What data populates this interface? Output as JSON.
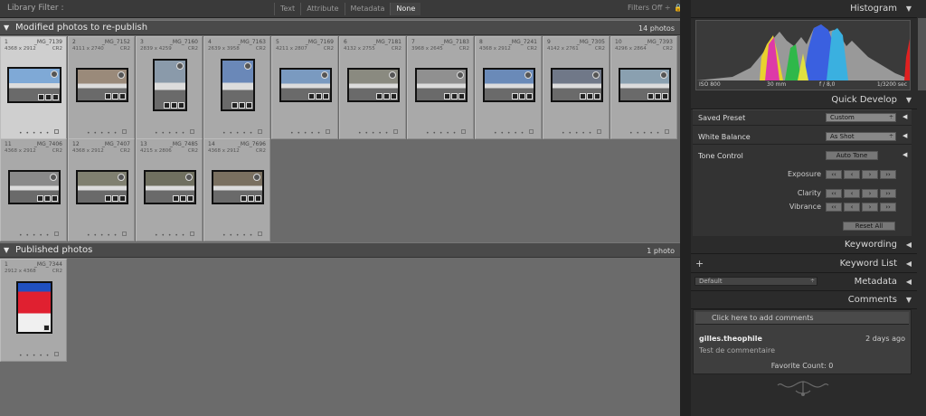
{
  "filter_bar": {
    "label": "Library Filter :",
    "options": [
      "Text",
      "Attribute",
      "Metadata",
      "None"
    ],
    "selected": "None",
    "filters_off": "Filters Off ÷"
  },
  "sections": [
    {
      "title": "Modified photos to re-publish",
      "count": "14 photos",
      "photos": [
        {
          "num": "1",
          "name": "_MG_7139",
          "dims": "4368 x 2912",
          "ext": "CR2"
        },
        {
          "num": "2",
          "name": "_MG_7152",
          "dims": "4111 x 2740",
          "ext": "CR2"
        },
        {
          "num": "3",
          "name": "_MG_7160",
          "dims": "2839 x 4259",
          "ext": "CR2"
        },
        {
          "num": "4",
          "name": "_MG_7163",
          "dims": "2639 x 3958",
          "ext": "CR2"
        },
        {
          "num": "5",
          "name": "_MG_7169",
          "dims": "4211 x 2807",
          "ext": "CR2"
        },
        {
          "num": "6",
          "name": "_MG_7181",
          "dims": "4132 x 2755",
          "ext": "CR2"
        },
        {
          "num": "7",
          "name": "_MG_7183",
          "dims": "3968 x 2645",
          "ext": "CR2"
        },
        {
          "num": "8",
          "name": "_MG_7241",
          "dims": "4368 x 2912",
          "ext": "CR2"
        },
        {
          "num": "9",
          "name": "_MG_7305",
          "dims": "4142 x 2761",
          "ext": "CR2"
        },
        {
          "num": "10",
          "name": "_MG_7393",
          "dims": "4296 x 2864",
          "ext": "CR2"
        },
        {
          "num": "11",
          "name": "_MG_7406",
          "dims": "4368 x 2912",
          "ext": "CR2"
        },
        {
          "num": "12",
          "name": "_MG_7407",
          "dims": "4368 x 2912",
          "ext": "CR2"
        },
        {
          "num": "13",
          "name": "_MG_7485",
          "dims": "4215 x 2806",
          "ext": "CR2"
        },
        {
          "num": "14",
          "name": "_MG_7696",
          "dims": "4368 x 2912",
          "ext": "CR2"
        }
      ]
    },
    {
      "title": "Published photos",
      "count": "1 photo",
      "photos": [
        {
          "num": "1",
          "name": "_MG_7344",
          "dims": "2912 x 4368",
          "ext": "CR2"
        }
      ]
    }
  ],
  "panels": {
    "histogram": {
      "title": "Histogram",
      "iso": "ISO 800",
      "focal": "30 mm",
      "aperture": "f / 8,0",
      "shutter": "1/3200 sec"
    },
    "quick_develop": {
      "title": "Quick Develop",
      "saved_preset_label": "Saved Preset",
      "saved_preset_value": "Custom",
      "white_balance_label": "White Balance",
      "white_balance_value": "As Shot",
      "tone_control_label": "Tone Control",
      "auto_tone": "Auto Tone",
      "exposure": "Exposure",
      "clarity": "Clarity",
      "vibrance": "Vibrance",
      "reset_all": "Reset All"
    },
    "keywording": {
      "title": "Keywording"
    },
    "keyword_list": {
      "title": "Keyword List",
      "plus": "+"
    },
    "metadata": {
      "title": "Metadata",
      "preset": "Default"
    },
    "comments": {
      "title": "Comments",
      "placeholder": "Click here to add comments",
      "author": "gilles.theophile",
      "time": "2 days ago",
      "text": "Test de commentaire",
      "favorite": "Favorite Count: 0"
    }
  },
  "colors": {
    "grid_bg": "#6b6b6b",
    "cell_bg": "#a9a9a9",
    "panel_bg": "#2b2b2b"
  }
}
